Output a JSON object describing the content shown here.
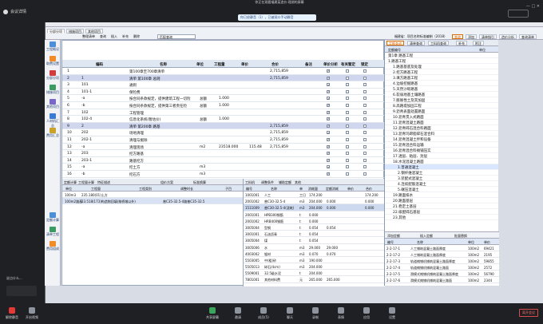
{
  "meeting": {
    "left_label": "会议详情",
    "title": "你正在观看福建某造价·理湖的屏幕",
    "notice": "你已经静音（1），已被观众手动静音",
    "leave_label": "离开会议"
  },
  "ribbon": {
    "tabs": [
      "分部分项",
      "措施项目",
      "其他项目",
      "人材机汇总",
      "费用汇总"
    ],
    "toolbar": [
      "整理清单",
      "查询",
      "插入",
      "补充",
      "删除"
    ],
    "search_value": "匹配查询",
    "right_chips": [
      "查询",
      "添加",
      "清单指引",
      "造价分析",
      "查询清单"
    ],
    "info_text": "福建省：项目名称标准编制（2018）"
  },
  "sidebar": {
    "items": [
      "工程概况",
      "取费设置",
      "分部分项",
      "措施项目",
      "其他项目",
      "人材机汇总",
      "费用汇总"
    ],
    "lower_items": [
      "定额计算",
      "清单工程",
      "费用组成"
    ]
  },
  "grid": {
    "headers": [
      "编码",
      "名称",
      "单位",
      "工程量",
      "单价",
      "合价",
      "备注",
      "单价分析",
      "有关暂定",
      "锁定"
    ],
    "rows": [
      {
        "code": "",
        "name": "第100章至700章清单",
        "unit": "",
        "qty": "",
        "price": "",
        "total": "2,715,859",
        "note": "",
        "hl": false,
        "lock": true
      },
      {
        "code": "1",
        "name": "清单 第100章 总则",
        "unit": "",
        "qty": "",
        "price": "",
        "total": "2,715,859",
        "note": "",
        "hl": true,
        "lock": true
      },
      {
        "code": "101",
        "name": "通则",
        "unit": "",
        "qty": "",
        "price": "",
        "total": "",
        "note": "",
        "hl": false,
        "lock": true
      },
      {
        "code": "101-1",
        "name": "保险费",
        "unit": "",
        "qty": "",
        "price": "",
        "total": "",
        "note": "",
        "hl": false,
        "lock": true
      },
      {
        "code": "-a",
        "name": "按合同条款规定，提供建筑工程一切险",
        "unit": "总额",
        "qty": "1.000",
        "price": "",
        "total": "",
        "note": "",
        "hl": false,
        "lock": true
      },
      {
        "code": "-b",
        "name": "按合同条款规定，提供第三者责任险",
        "unit": "总额",
        "qty": "1.000",
        "price": "",
        "total": "",
        "note": "",
        "hl": false,
        "lock": true
      },
      {
        "code": "102",
        "name": "工程管理",
        "unit": "",
        "qty": "",
        "price": "",
        "total": "",
        "note": "",
        "hl": false,
        "lock": true
      },
      {
        "code": "102-4",
        "name": "信息化系统(暂估价)",
        "unit": "总额",
        "qty": "1.000",
        "price": "",
        "total": "",
        "note": "",
        "hl": false,
        "lock": true
      },
      {
        "code": "2",
        "name": "清单 第200章 路基",
        "unit": "",
        "qty": "",
        "price": "",
        "total": "2,715,859",
        "note": "",
        "hl": true,
        "lock": true
      },
      {
        "code": "202",
        "name": "场地清理",
        "unit": "",
        "qty": "",
        "price": "",
        "total": "2,715,859",
        "note": "",
        "hl": false,
        "lock": true
      },
      {
        "code": "202-1",
        "name": "清理与掘除",
        "unit": "",
        "qty": "",
        "price": "",
        "total": "2,715,859",
        "note": "",
        "hl": false,
        "lock": true
      },
      {
        "code": "-a",
        "name": "清理现场",
        "unit": "m2",
        "qty": "23518.000",
        "price": "115.48",
        "total": "2,715,859",
        "note": "",
        "hl": false,
        "lock": true
      },
      {
        "code": "203",
        "name": "挖方路基",
        "unit": "",
        "qty": "",
        "price": "",
        "total": "",
        "note": "",
        "hl": false,
        "lock": true
      },
      {
        "code": "203-1",
        "name": "路基挖方",
        "unit": "",
        "qty": "",
        "price": "",
        "total": "",
        "note": "",
        "hl": false,
        "lock": true
      },
      {
        "code": "-a",
        "name": "挖土方",
        "unit": "m3",
        "qty": "",
        "price": "",
        "total": "",
        "note": "",
        "hl": false,
        "lock": true
      },
      {
        "code": "-b",
        "name": "挖石方",
        "unit": "m3",
        "qty": "",
        "price": "",
        "total": "",
        "note": "",
        "hl": false,
        "lock": true
      }
    ]
  },
  "bottom_left": {
    "tabs": [
      "定额计算",
      "工程量计算",
      "特征描述",
      "组价方案",
      "标准换算"
    ],
    "headers": [
      "单位",
      "工程量",
      "工程类别",
      "调整时长",
      "子目"
    ],
    "rows": [
      {
        "unit": "100m3",
        "qty": "235.180(01)土方",
        "type": "",
        "adj": "",
        "sub": ""
      },
      {
        "unit": "100m2路基",
        "qty": "23.518(173)构造物回填(按桥墩以外)",
        "type": "",
        "adj": "普C35-32.5-4路普C35-32.5",
        "sub": ""
      }
    ]
  },
  "mid_panel": {
    "tabs": [
      "工料机",
      "调整条件",
      "辅助定额",
      "其他"
    ],
    "headers": [
      "编号",
      "名称",
      "单",
      "消耗量",
      "定额消耗",
      "单价",
      "合价"
    ],
    "rows": [
      {
        "code": "1001001",
        "name": "人工",
        "unit": "工日",
        "qty": "174.200",
        "q2": "",
        "price": "",
        "total": "174.200"
      },
      {
        "code": "2001002",
        "name": "普C30-32.5-4",
        "unit": "m3",
        "qty": "204.000",
        "q2": "0.000",
        "price": "",
        "total": "0.000"
      },
      {
        "code": "1511009",
        "name": "普C30-32.5-4(浇筑)",
        "unit": "m3",
        "qty": "204.000",
        "q2": "0.000",
        "price": "",
        "total": "0.000"
      },
      {
        "code": "2001001",
        "name": "HPB300钢筋",
        "unit": "t",
        "qty": "0.000",
        "q2": "",
        "price": "",
        "total": ""
      },
      {
        "code": "2001002",
        "name": "HRB400钢筋",
        "unit": "t",
        "qty": "0.000",
        "q2": "",
        "price": "",
        "total": ""
      },
      {
        "code": "3005004",
        "name": "型钢",
        "unit": "t",
        "qty": "0.054",
        "q2": "0.054",
        "price": "",
        "total": ""
      },
      {
        "code": "3001001",
        "name": "石油沥青",
        "unit": "t",
        "qty": "0.054",
        "q2": "",
        "price": "",
        "total": ""
      },
      {
        "code": "3005004",
        "name": "煤",
        "unit": "t",
        "qty": "0.054",
        "q2": "",
        "price": "",
        "total": ""
      },
      {
        "code": "3005006",
        "name": "水",
        "unit": "m3",
        "qty": "29.000",
        "q2": "29.000",
        "price": "",
        "total": ""
      },
      {
        "code": "4003002",
        "name": "锯材",
        "unit": "m3",
        "qty": "0.070",
        "q2": "0.070",
        "price": "",
        "total": ""
      },
      {
        "code": "5503005",
        "name": "中(粗)砂",
        "unit": "m3",
        "qty": "190.000",
        "q2": "",
        "price": "",
        "total": ""
      },
      {
        "code": "5505013",
        "name": "碎石(4cm)",
        "unit": "m3",
        "qty": "204.000",
        "q2": "",
        "price": "",
        "total": ""
      },
      {
        "code": "5509001",
        "name": "32.5级水泥",
        "unit": "t",
        "qty": "204.000",
        "q2": "",
        "price": "",
        "total": ""
      },
      {
        "code": "7801001",
        "name": "其他材料费",
        "unit": "元",
        "qty": "265.000",
        "q2": "265.000",
        "price": "",
        "total": ""
      }
    ]
  },
  "right_panel": {
    "tabs": [
      "定额查询",
      "清单查询",
      "工料机查询",
      "补充",
      "附注"
    ],
    "tree_header": [
      "定额编号",
      "单位"
    ],
    "tree": [
      "第1章 路基工程",
      "1.路基工程",
      "1.路基基底及处理",
      "2.挖方路基工程",
      "3.填方路基工程",
      "4.边坡挖掘路基",
      "5.天然沙砾路基",
      "6.软弱地基土壤路基",
      "7.膨胀性土及其加固",
      "8.高路堤加固工程",
      "9.沥青表面处置路面",
      "10.沥青贯入式路面",
      "11.沥青混凝土路面",
      "12.沥青碎石混合料路面",
      "13.沥青玛蹄脂碎石混合料",
      "14.沥青混凝土拌和设备",
      "15.沥青混合料运输",
      "16.沥青混合料摊铺压实",
      "17.透层、粘层、封层",
      "18.水泥混凝土路面",
      "1.普通混凝土",
      "2.钢纤维混凝土",
      "3.装配式混凝土",
      "4.连续配筋混凝土",
      "5.碾压混凝土",
      "19.路面排水",
      "20.路面基层",
      "21.稳定土基层",
      "22.级配碎石基层",
      "23.其他"
    ],
    "bottom_tools": [
      "添加定额",
      "插入定额",
      "批量替换"
    ],
    "bottom_headers": [
      "编号",
      "名称",
      "单位",
      "单价"
    ],
    "bottom_rows": [
      {
        "code": "2-2-17-1",
        "name": "人工铺筑混凝土路面厚度",
        "unit": "100m2",
        "price": "69421"
      },
      {
        "code": "2-2-17-2",
        "name": "人工铺筑混凝土路面厚度",
        "unit": "100m2",
        "price": "2195"
      },
      {
        "code": "2-2-17-3",
        "name": "轨道摊铺机铺筑混凝土路面厚度",
        "unit": "100m2",
        "price": "59855"
      },
      {
        "code": "2-2-17-4",
        "name": "轨道摊铺机铺筑混凝土路面",
        "unit": "100m2",
        "price": "2572"
      },
      {
        "code": "2-2-17-5",
        "name": "滑模式摊铺机铺筑混凝土路面厚度",
        "unit": "100m2",
        "price": "56790"
      },
      {
        "code": "2-2-17-6",
        "name": "滑模式摊铺机铺筑混凝土路面",
        "unit": "100m2",
        "price": "2344"
      }
    ]
  },
  "bottom_bar": {
    "items": [
      "解除静音",
      "开启视频",
      "共享屏幕",
      "邀请",
      "成员(5)",
      "聊天",
      "录制",
      "表情",
      "应用",
      "设置"
    ],
    "left_label": "说点什么..."
  }
}
